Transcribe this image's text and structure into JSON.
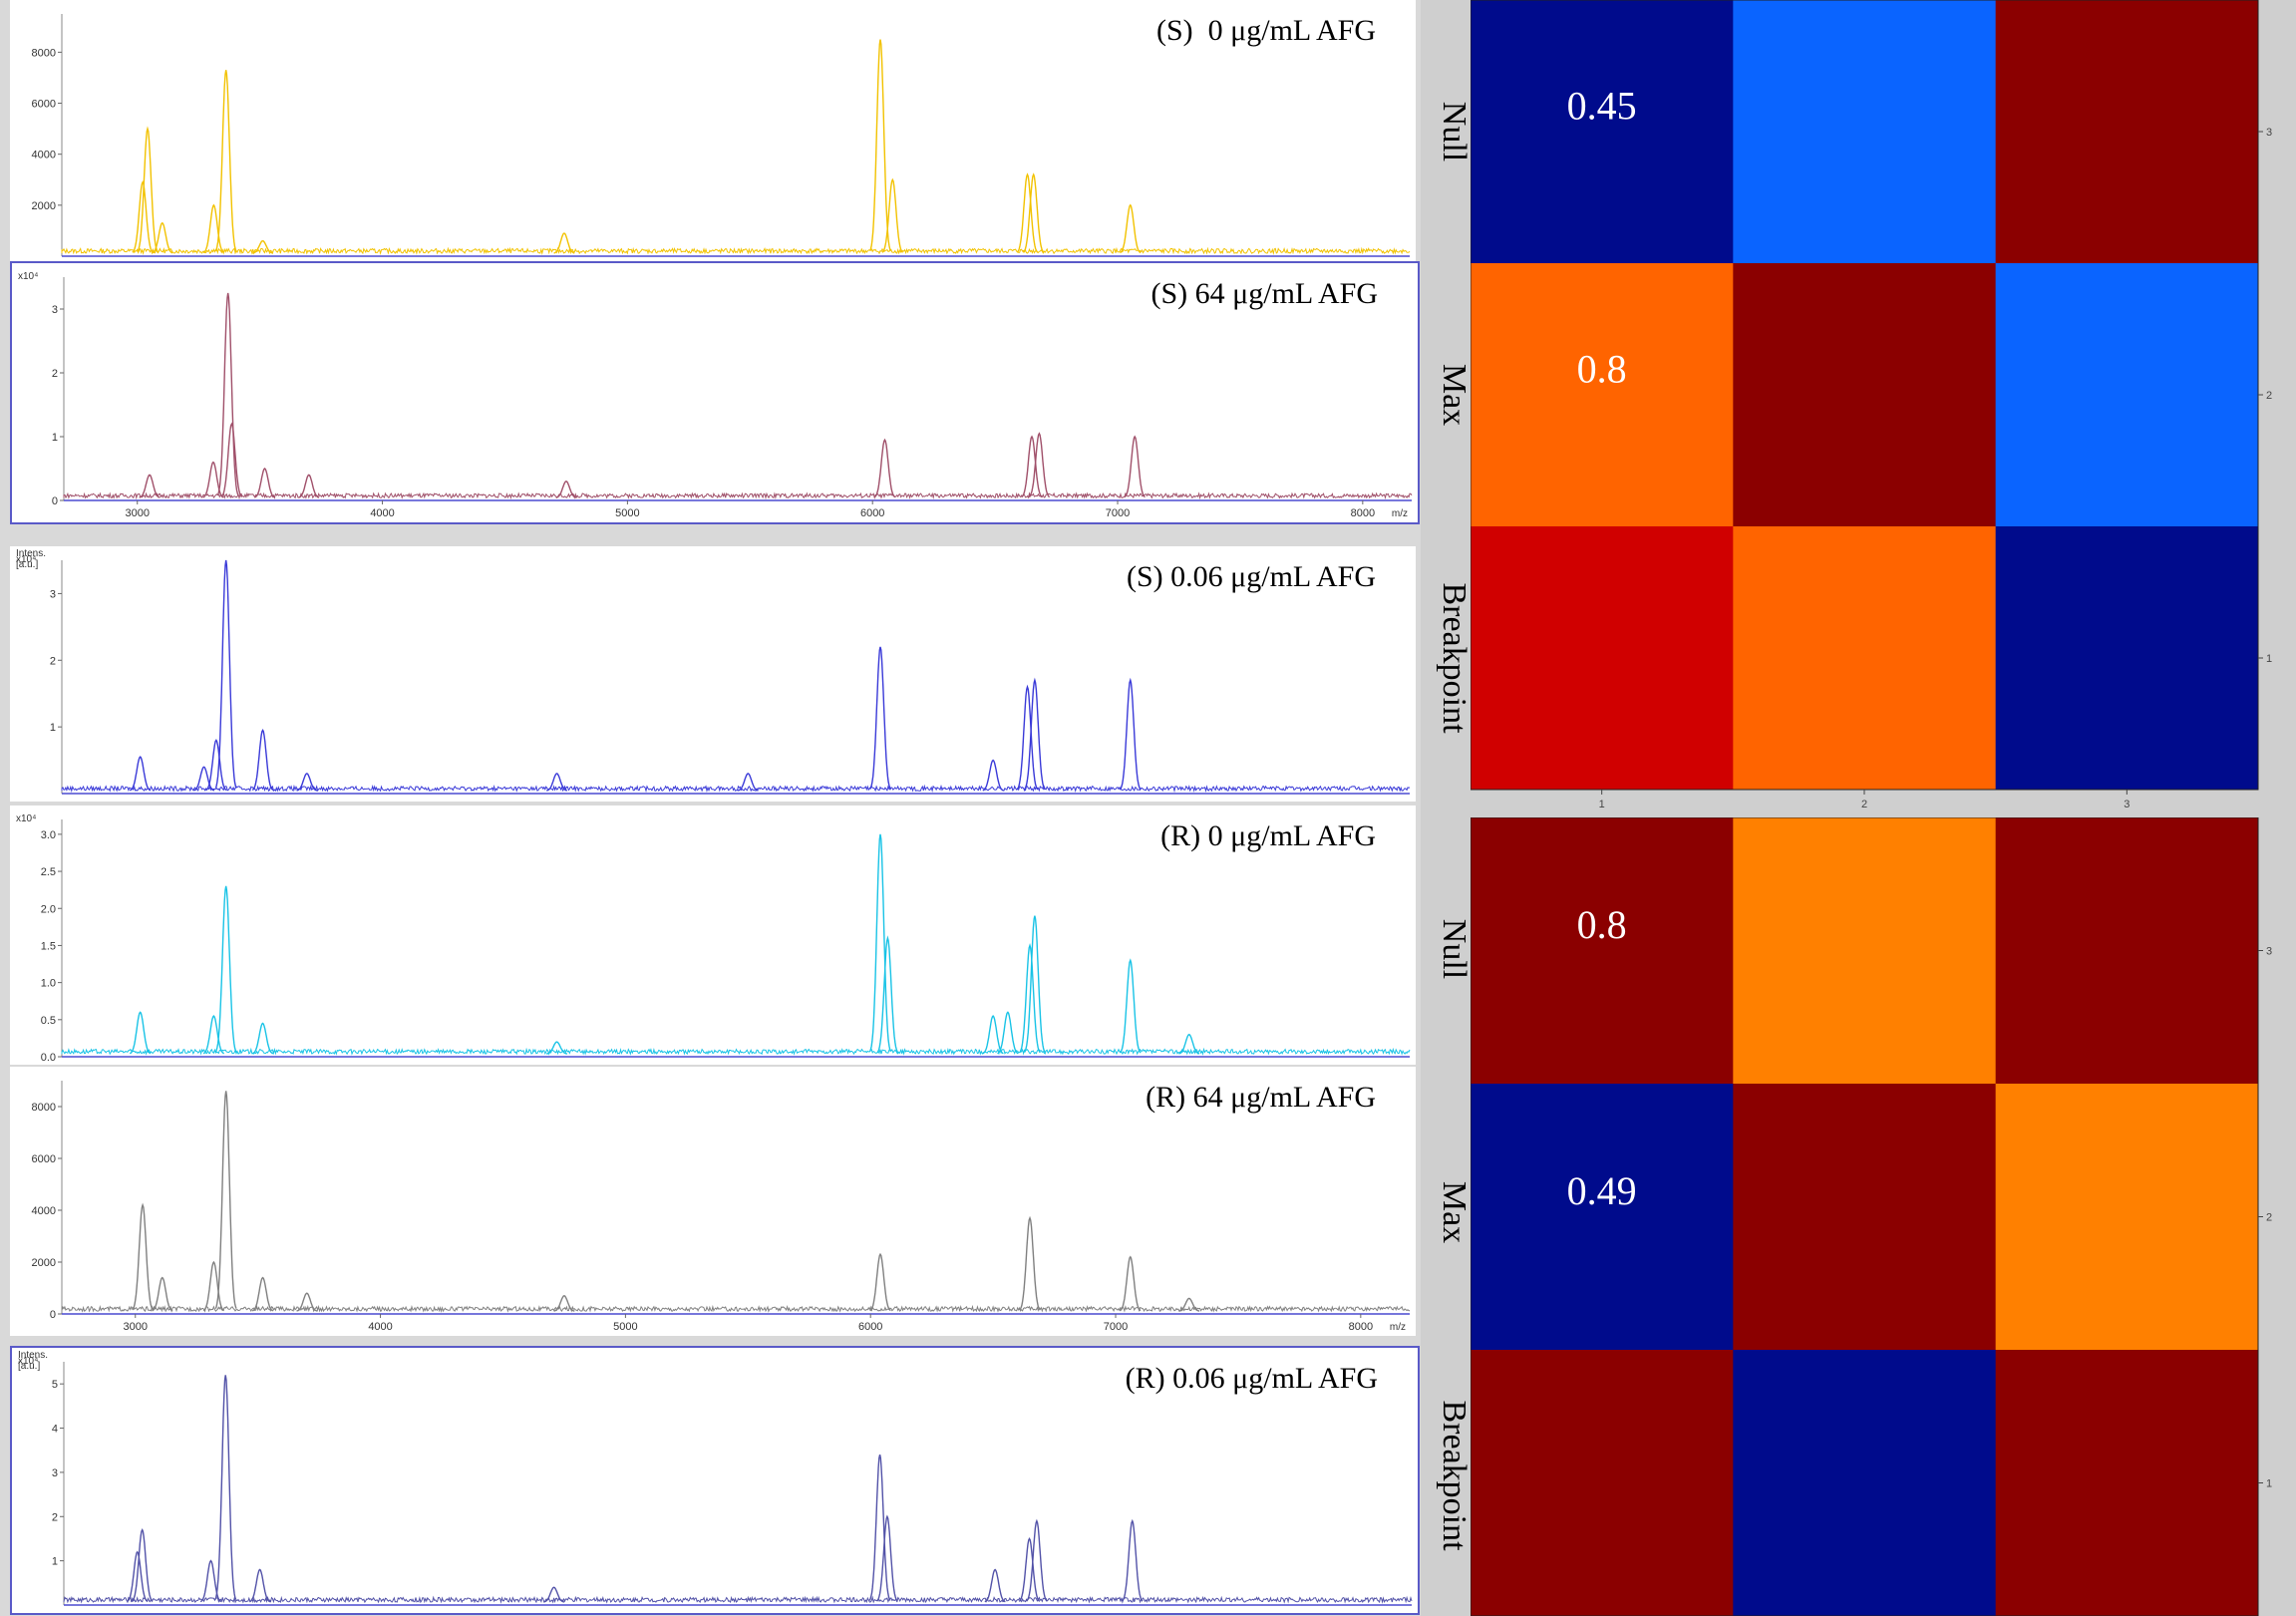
{
  "colors": {
    "series": [
      "#f2c200",
      "#a0506a",
      "#3a3ad8",
      "#19c3e6",
      "#808080",
      "#5252a8"
    ],
    "heatmap": {
      "0.45": "#000b8c",
      "0.49": "#000b8c",
      "0.8": "#8b0000",
      "blue": "#0a64ff",
      "orange_red": "#ff6400",
      "orange": "#ff8000",
      "red": "#d00000"
    }
  },
  "chart_data": [
    {
      "type": "line",
      "title": "(S)  0 μg/mL AFG",
      "xlim": [
        2700,
        8200
      ],
      "ylim": [
        0,
        9500
      ],
      "yticks": [
        {
          "v": 2000,
          "label": "2000"
        },
        {
          "v": 4000,
          "label": "4000"
        },
        {
          "v": 6000,
          "label": "6000"
        },
        {
          "v": 8000,
          "label": "8000"
        }
      ],
      "peaks": [
        {
          "x": 3030,
          "y": 2900
        },
        {
          "x": 3050,
          "y": 5000
        },
        {
          "x": 3110,
          "y": 1300
        },
        {
          "x": 3320,
          "y": 2000
        },
        {
          "x": 3370,
          "y": 7300
        },
        {
          "x": 3520,
          "y": 600
        },
        {
          "x": 4750,
          "y": 900
        },
        {
          "x": 6040,
          "y": 8500
        },
        {
          "x": 6090,
          "y": 3000
        },
        {
          "x": 6640,
          "y": 3200
        },
        {
          "x": 6665,
          "y": 3200
        },
        {
          "x": 7060,
          "y": 2000
        }
      ]
    },
    {
      "type": "line",
      "title": "(S) 64 μg/mL AFG",
      "xlim": [
        2700,
        8200
      ],
      "ylim": [
        0,
        3.5
      ],
      "yticks": [
        {
          "v": 0,
          "label": "0"
        },
        {
          "v": 1,
          "label": "1"
        },
        {
          "v": 2,
          "label": "2"
        },
        {
          "v": 3,
          "label": "3"
        }
      ],
      "scale_label": "x10⁴",
      "xticks": [
        {
          "v": 3000,
          "label": "3000"
        },
        {
          "v": 4000,
          "label": "4000"
        },
        {
          "v": 5000,
          "label": "5000"
        },
        {
          "v": 6000,
          "label": "6000"
        },
        {
          "v": 7000,
          "label": "7000"
        },
        {
          "v": 8000,
          "label": "8000"
        }
      ],
      "xunit": "m/z",
      "peaks": [
        {
          "x": 3050,
          "y": 0.4
        },
        {
          "x": 3310,
          "y": 0.6
        },
        {
          "x": 3370,
          "y": 3.25
        },
        {
          "x": 3385,
          "y": 1.2
        },
        {
          "x": 3520,
          "y": 0.5
        },
        {
          "x": 3700,
          "y": 0.4
        },
        {
          "x": 4750,
          "y": 0.3
        },
        {
          "x": 6050,
          "y": 0.95
        },
        {
          "x": 6650,
          "y": 1.0
        },
        {
          "x": 6680,
          "y": 1.05
        },
        {
          "x": 7070,
          "y": 1.0
        }
      ]
    },
    {
      "type": "line",
      "title": "(S) 0.06 μg/mL AFG",
      "xlim": [
        2700,
        8200
      ],
      "ylim": [
        0,
        3.5
      ],
      "yticks": [
        {
          "v": 1,
          "label": "1"
        },
        {
          "v": 2,
          "label": "2"
        },
        {
          "v": 3,
          "label": "3"
        }
      ],
      "ylabel": "Intens.\n[a.u.]",
      "scale_label": "x10⁴",
      "peaks": [
        {
          "x": 3020,
          "y": 0.55
        },
        {
          "x": 3280,
          "y": 0.4
        },
        {
          "x": 3330,
          "y": 0.8
        },
        {
          "x": 3370,
          "y": 3.5
        },
        {
          "x": 3520,
          "y": 0.95
        },
        {
          "x": 3700,
          "y": 0.3
        },
        {
          "x": 4720,
          "y": 0.3
        },
        {
          "x": 5500,
          "y": 0.3
        },
        {
          "x": 6040,
          "y": 2.2
        },
        {
          "x": 6500,
          "y": 0.5
        },
        {
          "x": 6640,
          "y": 1.6
        },
        {
          "x": 6670,
          "y": 1.7
        },
        {
          "x": 7060,
          "y": 1.7
        }
      ]
    },
    {
      "type": "line",
      "title": "(R) 0 μg/mL AFG",
      "xlim": [
        2700,
        8200
      ],
      "ylim": [
        0,
        3.2
      ],
      "yticks": [
        {
          "v": 0,
          "label": "0.0"
        },
        {
          "v": 0.5,
          "label": "0.5"
        },
        {
          "v": 1.0,
          "label": "1.0"
        },
        {
          "v": 1.5,
          "label": "1.5"
        },
        {
          "v": 2.0,
          "label": "2.0"
        },
        {
          "v": 2.5,
          "label": "2.5"
        },
        {
          "v": 3.0,
          "label": "3.0"
        }
      ],
      "scale_label": "x10⁴",
      "peaks": [
        {
          "x": 3020,
          "y": 0.6
        },
        {
          "x": 3320,
          "y": 0.55
        },
        {
          "x": 3370,
          "y": 2.3
        },
        {
          "x": 3520,
          "y": 0.45
        },
        {
          "x": 4720,
          "y": 0.2
        },
        {
          "x": 6040,
          "y": 3.0
        },
        {
          "x": 6070,
          "y": 1.6
        },
        {
          "x": 6500,
          "y": 0.55
        },
        {
          "x": 6560,
          "y": 0.6
        },
        {
          "x": 6650,
          "y": 1.5
        },
        {
          "x": 6670,
          "y": 1.9
        },
        {
          "x": 7060,
          "y": 1.3
        },
        {
          "x": 7300,
          "y": 0.3
        }
      ]
    },
    {
      "type": "line",
      "title": "(R) 64 μg/mL AFG",
      "xlim": [
        2700,
        8200
      ],
      "ylim": [
        0,
        9000
      ],
      "yticks": [
        {
          "v": 0,
          "label": "0"
        },
        {
          "v": 2000,
          "label": "2000"
        },
        {
          "v": 4000,
          "label": "4000"
        },
        {
          "v": 6000,
          "label": "6000"
        },
        {
          "v": 8000,
          "label": "8000"
        }
      ],
      "xticks": [
        {
          "v": 3000,
          "label": "3000"
        },
        {
          "v": 4000,
          "label": "4000"
        },
        {
          "v": 5000,
          "label": "5000"
        },
        {
          "v": 6000,
          "label": "6000"
        },
        {
          "v": 7000,
          "label": "7000"
        },
        {
          "v": 8000,
          "label": "8000"
        }
      ],
      "xunit": "m/z",
      "peaks": [
        {
          "x": 3030,
          "y": 4200
        },
        {
          "x": 3110,
          "y": 1400
        },
        {
          "x": 3320,
          "y": 2000
        },
        {
          "x": 3370,
          "y": 8600
        },
        {
          "x": 3520,
          "y": 1400
        },
        {
          "x": 3700,
          "y": 800
        },
        {
          "x": 4750,
          "y": 700
        },
        {
          "x": 6040,
          "y": 2300
        },
        {
          "x": 6650,
          "y": 3700
        },
        {
          "x": 7060,
          "y": 2200
        },
        {
          "x": 7300,
          "y": 600
        }
      ]
    },
    {
      "type": "line",
      "title": "(R) 0.06 μg/mL AFG",
      "xlim": [
        2700,
        8200
      ],
      "ylim": [
        0,
        5.5
      ],
      "yticks": [
        {
          "v": 1,
          "label": "1"
        },
        {
          "v": 2,
          "label": "2"
        },
        {
          "v": 3,
          "label": "3"
        },
        {
          "v": 4,
          "label": "4"
        },
        {
          "v": 5,
          "label": "5"
        }
      ],
      "ylabel": "Intens.\n[a.u.]",
      "scale_label": "x10⁴",
      "peaks": [
        {
          "x": 3000,
          "y": 1.2
        },
        {
          "x": 3020,
          "y": 1.7
        },
        {
          "x": 3300,
          "y": 1.0
        },
        {
          "x": 3360,
          "y": 5.2
        },
        {
          "x": 3500,
          "y": 0.8
        },
        {
          "x": 4700,
          "y": 0.4
        },
        {
          "x": 6030,
          "y": 3.4
        },
        {
          "x": 6060,
          "y": 2.0
        },
        {
          "x": 6500,
          "y": 0.8
        },
        {
          "x": 6640,
          "y": 1.5
        },
        {
          "x": 6670,
          "y": 1.9
        },
        {
          "x": 7060,
          "y": 1.9
        }
      ]
    },
    {
      "type": "heatmap",
      "rows": [
        "Null",
        "Max",
        "Breakpoint"
      ],
      "xticks": [
        "1",
        "2",
        "3"
      ],
      "yticks": [
        "3",
        "2",
        "1"
      ],
      "cells": [
        [
          {
            "value": "0.45",
            "color": "#000b8c"
          },
          {
            "value": "",
            "color": "#0a64ff"
          },
          {
            "value": "",
            "color": "#8b0000"
          }
        ],
        [
          {
            "value": "0.8",
            "color": "#ff6400"
          },
          {
            "value": "",
            "color": "#8b0000"
          },
          {
            "value": "",
            "color": "#0a64ff"
          }
        ],
        [
          {
            "value": "",
            "color": "#d00000"
          },
          {
            "value": "",
            "color": "#ff6400"
          },
          {
            "value": "",
            "color": "#000b8c"
          }
        ]
      ]
    },
    {
      "type": "heatmap",
      "rows": [
        "Null",
        "Max",
        "Breakpoint"
      ],
      "yticks": [
        "3",
        "2",
        "1"
      ],
      "cells": [
        [
          {
            "value": "0.8",
            "color": "#8b0000"
          },
          {
            "value": "",
            "color": "#ff8000"
          },
          {
            "value": "",
            "color": "#8b0000"
          }
        ],
        [
          {
            "value": "0.49",
            "color": "#000b8c"
          },
          {
            "value": "",
            "color": "#8b0000"
          },
          {
            "value": "",
            "color": "#ff8000"
          }
        ],
        [
          {
            "value": "",
            "color": "#8b0000"
          },
          {
            "value": "",
            "color": "#000b8c"
          },
          {
            "value": "",
            "color": "#8b0000"
          }
        ]
      ]
    }
  ]
}
